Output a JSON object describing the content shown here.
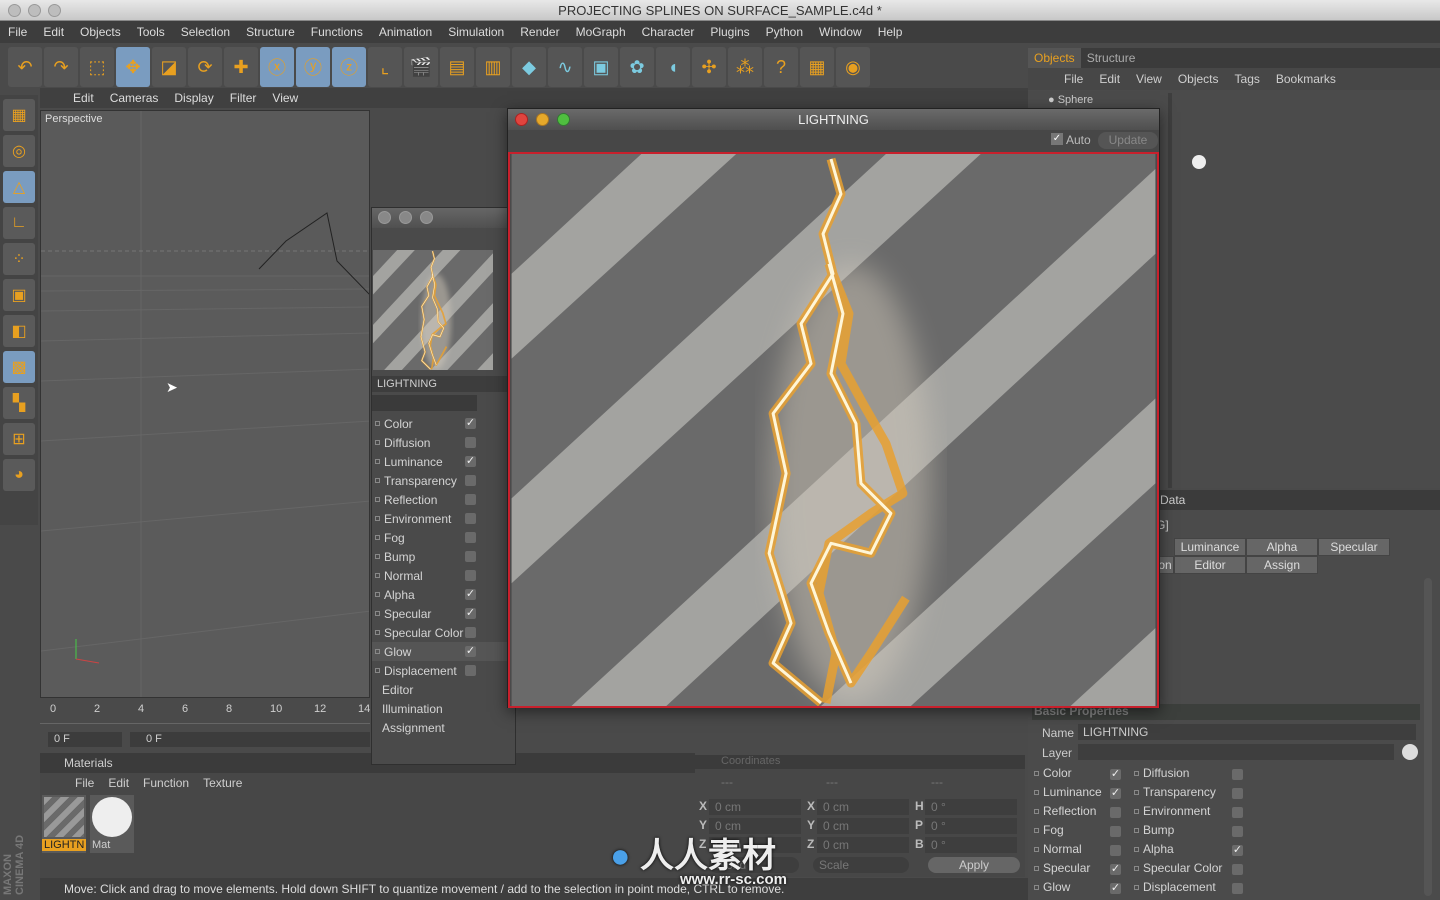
{
  "window": {
    "title": "PROJECTING SPLINES ON SURFACE_SAMPLE.c4d *"
  },
  "menu": [
    "File",
    "Edit",
    "Objects",
    "Tools",
    "Selection",
    "Structure",
    "Functions",
    "Animation",
    "Simulation",
    "Render",
    "MoGraph",
    "Character",
    "Plugins",
    "Python",
    "Window",
    "Help"
  ],
  "toolbar_icons": [
    "undo-icon",
    "redo-icon",
    "live-selection-icon",
    "move-icon",
    "scale-icon",
    "rotate-icon",
    "move-tool-icon",
    "x-axis-icon",
    "y-axis-icon",
    "z-axis-icon",
    "coordinate-system-icon",
    "render-view-icon",
    "render-picture-viewer-icon",
    "render-settings-icon",
    "cube-icon",
    "spline-pen-icon",
    "nurbs-icon",
    "array-icon",
    "deformer-icon",
    "scene-icon",
    "particle-icon",
    "help-icon",
    "preferences-icon",
    "render-region-icon"
  ],
  "viewport": {
    "menu": [
      "Edit",
      "Cameras",
      "Display",
      "Filter",
      "View"
    ],
    "label": "Perspective"
  },
  "timeline": {
    "ticks": [
      "0",
      "2",
      "4",
      "6",
      "8",
      "10",
      "12",
      "14"
    ],
    "current_frame": "0 F",
    "start_frame": "0 F"
  },
  "materials": {
    "title": "Materials",
    "menu": [
      "File",
      "Edit",
      "Function",
      "Texture"
    ],
    "items": [
      {
        "name": "LIGHTN",
        "selected": true
      },
      {
        "name": "Mat",
        "selected": false
      }
    ]
  },
  "status": "Move: Click and drag to move elements. Hold down SHIFT to quantize movement / add to the selection in point mode, CTRL to remove.",
  "objects": {
    "tabs": [
      "Objects",
      "Structure"
    ],
    "menu": [
      "File",
      "Edit",
      "View",
      "Objects",
      "Tags",
      "Bookmarks"
    ],
    "items": [
      "Sphere"
    ]
  },
  "material_editor": {
    "name": "LIGHTNING",
    "channels": [
      {
        "label": "Color",
        "checked": true
      },
      {
        "label": "Diffusion",
        "checked": false
      },
      {
        "label": "Luminance",
        "checked": true
      },
      {
        "label": "Transparency",
        "checked": false
      },
      {
        "label": "Reflection",
        "checked": false
      },
      {
        "label": "Environment",
        "checked": false
      },
      {
        "label": "Fog",
        "checked": false
      },
      {
        "label": "Bump",
        "checked": false
      },
      {
        "label": "Normal",
        "checked": false
      },
      {
        "label": "Alpha",
        "checked": true
      },
      {
        "label": "Specular",
        "checked": true
      },
      {
        "label": "Specular Color",
        "checked": false
      },
      {
        "label": "Glow",
        "checked": true
      },
      {
        "label": "Displacement",
        "checked": false
      }
    ],
    "extra": [
      "Editor",
      "Illumination",
      "Assignment"
    ]
  },
  "preview_window": {
    "title": "LIGHTNING",
    "auto_label": "Auto",
    "auto_checked": true,
    "update_label": "Update"
  },
  "attributes": {
    "mode_label": "Data",
    "title_fragment": "G]",
    "tabs_row1": [
      "Luminance",
      "Alpha",
      "Specular"
    ],
    "tabs_row2": [
      "on",
      "Editor",
      "Assign"
    ],
    "section": "Basic Properties",
    "name_label": "Name",
    "name_value": "LIGHTNING",
    "layer_label": "Layer",
    "left_channels": [
      {
        "label": "Color",
        "checked": true
      },
      {
        "label": "Luminance",
        "checked": true
      },
      {
        "label": "Reflection",
        "checked": false
      },
      {
        "label": "Fog",
        "checked": false
      },
      {
        "label": "Normal",
        "checked": false
      },
      {
        "label": "Specular",
        "checked": true
      },
      {
        "label": "Glow",
        "checked": true
      }
    ],
    "right_channels": [
      {
        "label": "Diffusion",
        "checked": false
      },
      {
        "label": "Transparency",
        "checked": false
      },
      {
        "label": "Environment",
        "checked": false
      },
      {
        "label": "Bump",
        "checked": false
      },
      {
        "label": "Alpha",
        "checked": true
      },
      {
        "label": "Specular Color",
        "checked": false
      },
      {
        "label": "Displacement",
        "checked": false
      }
    ]
  },
  "coordinates": {
    "title": "Coordinates",
    "headers": [
      "---",
      "---",
      "---"
    ],
    "rows": [
      {
        "l1": "X",
        "v1": "0 cm",
        "l2": "X",
        "v2": "0 cm",
        "l3": "H",
        "v3": "0 °"
      },
      {
        "l1": "Y",
        "v1": "0 cm",
        "l2": "Y",
        "v2": "0 cm",
        "l3": "P",
        "v3": "0 °"
      },
      {
        "l1": "Z",
        "v1": "0 cm",
        "l2": "Z",
        "v2": "0 cm",
        "l3": "B",
        "v3": "0 °"
      }
    ],
    "mode1": "World",
    "mode2": "Scale",
    "apply_label": "Apply"
  },
  "branding": {
    "app_logo": "MAXON CINEMA 4D",
    "watermark": "人人素材 www.rr-sc.com"
  },
  "colors": {
    "accent": "#7a9cc0",
    "selection_border": "#c8202c",
    "orange": "#e8a020"
  }
}
